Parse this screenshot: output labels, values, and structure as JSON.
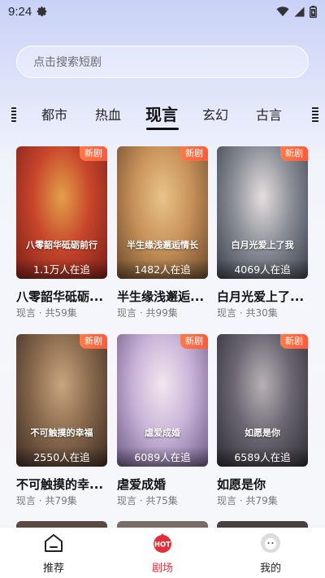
{
  "status_bar": {
    "time": "9:24",
    "icons": [
      "gear-icon",
      "wifi-icon",
      "signal-icon",
      "battery-icon"
    ]
  },
  "search": {
    "placeholder": "点击搜索短剧"
  },
  "tabs": [
    {
      "label": "都市",
      "active": false
    },
    {
      "label": "热血",
      "active": false
    },
    {
      "label": "现言",
      "active": true
    },
    {
      "label": "玄幻",
      "active": false
    },
    {
      "label": "古言",
      "active": false
    }
  ],
  "cards": [
    {
      "title": "八零韶华砥砺...",
      "poster_text": "八零韶华砥砺前行",
      "badge": "新剧",
      "followers": "1.1万人在追",
      "meta": "现言 · 共59集",
      "colors": [
        "#7a1f19",
        "#c8452b",
        "#e2a04a"
      ]
    },
    {
      "title": "半生缘浅邂逅...",
      "poster_text": "半生缘浅邂逅情长",
      "badge": "新剧",
      "followers": "1482人在追",
      "meta": "现言 · 共99集",
      "colors": [
        "#6b4a2c",
        "#c8915a",
        "#e8c48a"
      ]
    },
    {
      "title": "白月光爱上了...",
      "poster_text": "白月光爱上了我",
      "badge": "新剧",
      "followers": "4069人在追",
      "meta": "现言 · 共30集",
      "colors": [
        "#3a3f4a",
        "#8c8f98",
        "#e4dede"
      ]
    },
    {
      "title": "不可触摸的幸...",
      "poster_text": "不可触摸的幸福",
      "badge": "新剧",
      "followers": "2550人在追",
      "meta": "现言 · 共79集",
      "colors": [
        "#3d2c22",
        "#8a6a4e",
        "#c9a57d"
      ]
    },
    {
      "title": "虐爱成婚",
      "poster_text": "虐爱成婚",
      "badge": "新剧",
      "followers": "6089人在追",
      "meta": "现言 · 共75集",
      "colors": [
        "#6f5a86",
        "#c9b4d9",
        "#f3e6ef"
      ]
    },
    {
      "title": "如愿是你",
      "poster_text": "如愿是你",
      "badge": "新剧",
      "followers": "6589人在追",
      "meta": "现言 · 共79集",
      "colors": [
        "#2e2c33",
        "#6b6772",
        "#b8b1b6"
      ]
    }
  ],
  "bottom_nav": [
    {
      "label": "推荐",
      "icon": "home-icon",
      "active": false
    },
    {
      "label": "剧场",
      "icon": "hot-icon",
      "active": true,
      "icon_text": "HOT"
    },
    {
      "label": "我的",
      "icon": "profile-icon",
      "active": false
    }
  ],
  "colors": {
    "accent": "#e0313a",
    "badge": "#ff6a40"
  }
}
